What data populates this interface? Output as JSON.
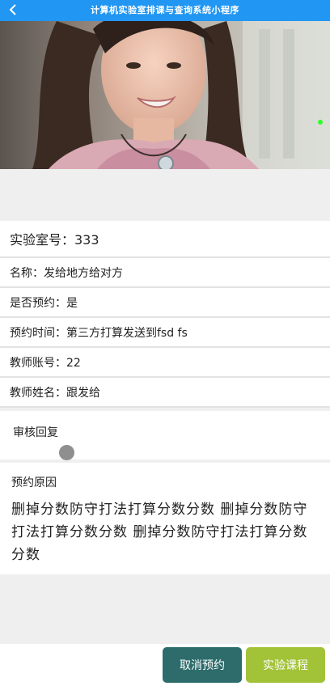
{
  "header": {
    "title": "计算机实验室排课与查询系统小程序",
    "back_icon": "chevron-left-icon"
  },
  "banner": {
    "image": "portrait-photo"
  },
  "details": {
    "lab_number": "实验室号：333",
    "name": "名称：发给地方给对方",
    "reserved": "是否预约：是",
    "reserve_time": "预约时间：第三方打算发送到fsd fs",
    "teacher_account": "教师账号：22",
    "teacher_name": "教师姓名：跟发给"
  },
  "review": {
    "label": "审核回复"
  },
  "reason": {
    "label": "预约原因",
    "text": "删掉分数防守打法打算分数分数 删掉分数防守打法打算分数分数 删掉分数防守打法打算分数分数"
  },
  "actions": {
    "cancel_label": "取消预约",
    "course_label": "实验课程"
  },
  "colors": {
    "header_bg": "#2196f3",
    "cancel_button": "#2e6c6c",
    "course_button": "#a2c338"
  }
}
